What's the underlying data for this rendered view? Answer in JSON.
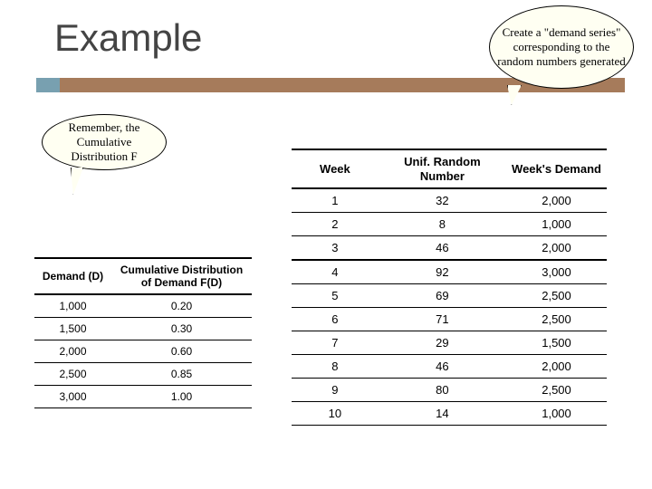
{
  "title": "Example",
  "callouts": {
    "top": "Create a \"demand series\" corresponding to the random numbers generated",
    "left": "Remember, the Cumulative Distribution F"
  },
  "left_table": {
    "headers": [
      "Demand (D)",
      "Cumulative Distribution of Demand F(D)"
    ],
    "rows": [
      [
        "1,000",
        "0.20"
      ],
      [
        "1,500",
        "0.30"
      ],
      [
        "2,000",
        "0.60"
      ],
      [
        "2,500",
        "0.85"
      ],
      [
        "3,000",
        "1.00"
      ]
    ]
  },
  "right_table": {
    "headers": [
      "Week",
      "Unif. Random Number",
      "Week's Demand"
    ],
    "rows": [
      [
        "1",
        "32",
        "2,000"
      ],
      [
        "2",
        "8",
        "1,000"
      ],
      [
        "3",
        "46",
        "2,000"
      ],
      [
        "4",
        "92",
        "3,000"
      ],
      [
        "5",
        "69",
        "2,500"
      ],
      [
        "6",
        "71",
        "2,500"
      ],
      [
        "7",
        "29",
        "1,500"
      ],
      [
        "8",
        "46",
        "2,000"
      ],
      [
        "9",
        "80",
        "2,500"
      ],
      [
        "10",
        "14",
        "1,000"
      ]
    ]
  }
}
